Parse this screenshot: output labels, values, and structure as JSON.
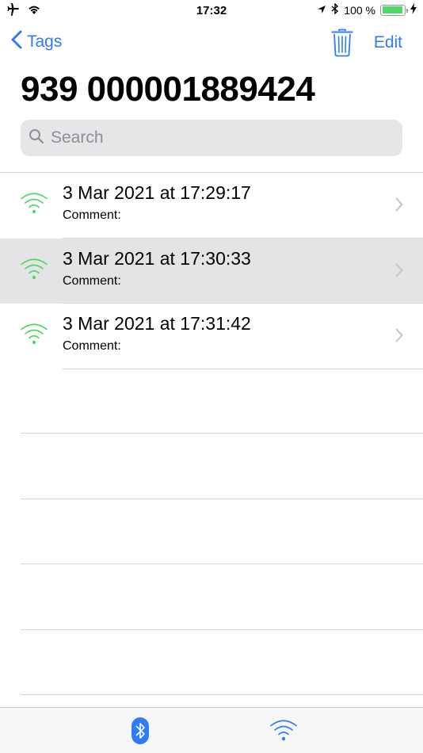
{
  "status_bar": {
    "time": "17:32",
    "battery_percent": "100 %",
    "left_icons": [
      "airplane-icon",
      "wifi-icon"
    ],
    "right_icons": [
      "location-arrow-icon",
      "bluetooth-icon",
      "battery-icon",
      "charging-bolt-icon"
    ]
  },
  "nav": {
    "back_label": "Tags",
    "edit_label": "Edit",
    "title": "939 000001889424"
  },
  "search": {
    "placeholder": "Search",
    "value": ""
  },
  "list": {
    "items": [
      {
        "title": "3 Mar 2021 at 17:29:17",
        "subtitle": "Comment:",
        "icon": "nfc-signal-icon",
        "selected": false
      },
      {
        "title": "3 Mar 2021 at 17:30:33",
        "subtitle": "Comment:",
        "icon": "nfc-signal-icon",
        "selected": true
      },
      {
        "title": "3 Mar 2021 at 17:31:42",
        "subtitle": "Comment:",
        "icon": "nfc-signal-icon",
        "selected": false
      }
    ]
  },
  "tab_bar": {
    "tabs": [
      {
        "name": "bluetooth-tab",
        "icon": "bluetooth-badge-icon"
      },
      {
        "name": "nfc-tab",
        "icon": "wireless-signal-icon"
      }
    ]
  },
  "colors": {
    "accent": "#2f7cf6",
    "signal_green": "#4cd964",
    "selected_row": "#e4e4e6"
  }
}
